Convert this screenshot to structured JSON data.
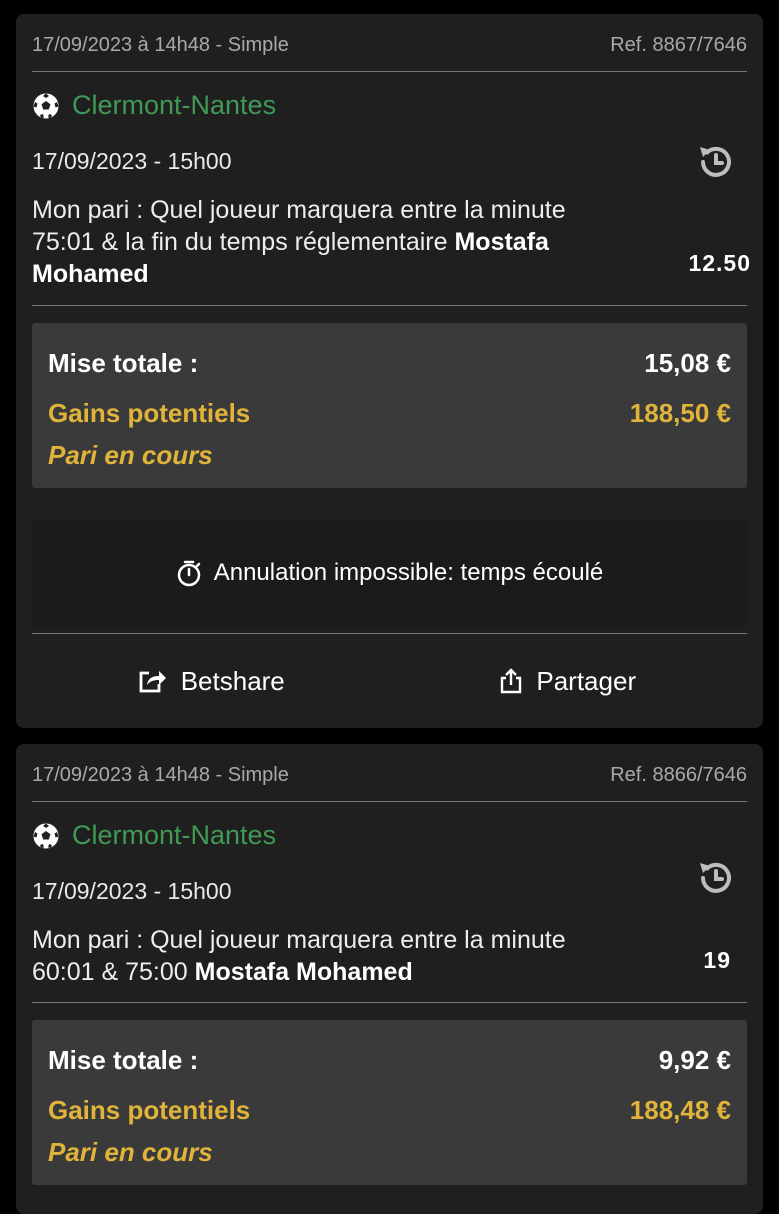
{
  "bets": [
    {
      "placed": "17/09/2023 à 14h48 - Simple",
      "ref": "Ref. 8867/7646",
      "match": "Clermont-Nantes",
      "match_date": "17/09/2023 - 15h00",
      "bet_text": "Mon pari : Quel joueur marquera entre la minute 75:01 & la fin du temps réglementaire ",
      "player": "Mostafa Mohamed",
      "odds": "12.50",
      "stake_label": "Mise totale :",
      "stake": "15,08 €",
      "gains_label": "Gains potentiels",
      "gains": "188,50 €",
      "status": "Pari en cours",
      "cancel_text": "Annulation impossible: temps écoulé",
      "betshare": "Betshare",
      "share": "Partager"
    },
    {
      "placed": "17/09/2023 à 14h48 - Simple",
      "ref": "Ref. 8866/7646",
      "match": "Clermont-Nantes",
      "match_date": "17/09/2023 - 15h00",
      "bet_text": "Mon pari : Quel joueur marquera entre la minute 60:01 & 75:00 ",
      "player": "Mostafa Mohamed",
      "odds": "19",
      "stake_label": "Mise totale :",
      "stake": "9,92 €",
      "gains_label": "Gains potentiels",
      "gains": "188,48 €",
      "status": "Pari en cours"
    }
  ],
  "colors": {
    "match_green": "#3f9a55",
    "gain_gold": "#e0b43a",
    "card_bg": "#1f1f1f",
    "summary_bg": "#3a3a3a"
  },
  "icons": [
    "football-icon",
    "history-icon",
    "timer-icon",
    "betshare-icon",
    "share-icon"
  ]
}
